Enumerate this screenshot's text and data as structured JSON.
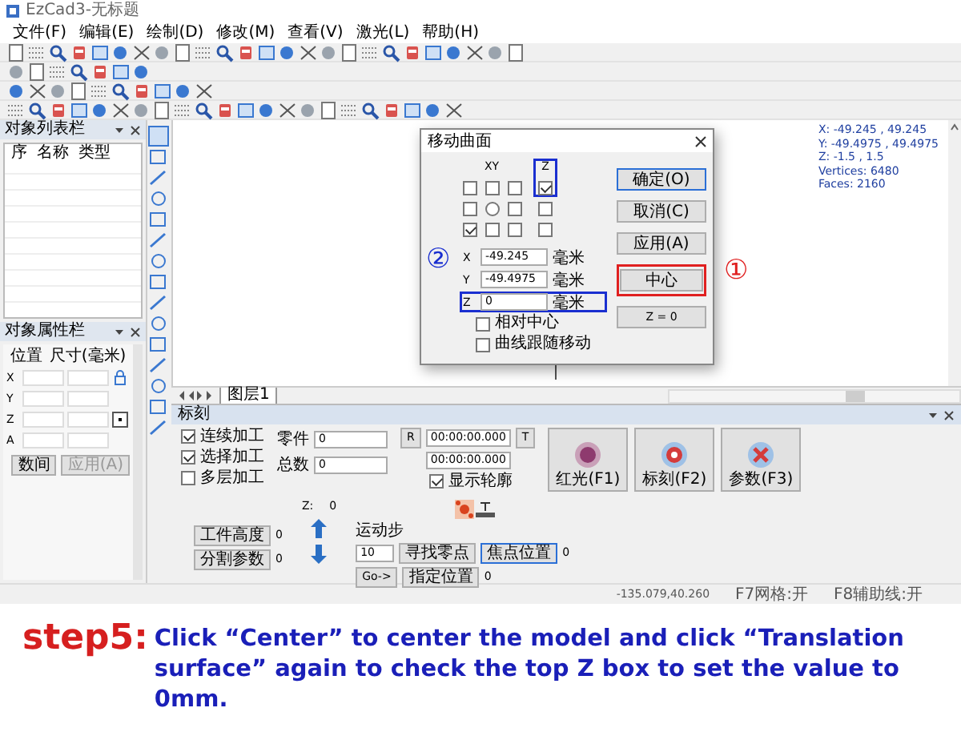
{
  "window": {
    "title": "EzCad3-无标题"
  },
  "menu": [
    "文件(F)",
    "编辑(E)",
    "绘制(D)",
    "修改(M)",
    "查看(V)",
    "激光(L)",
    "帮助(H)"
  ],
  "object_list": {
    "title": "对象列表栏",
    "columns": [
      "序",
      "名称",
      "类型"
    ]
  },
  "object_properties": {
    "title": "对象属性栏",
    "columns": [
      "位置",
      "尺寸(毫米)"
    ],
    "rows": [
      "X",
      "Y",
      "Z",
      "A"
    ],
    "direction_label": "数间",
    "apply_button": {
      "label": "应用(A)",
      "disabled": true
    }
  },
  "canvas": {
    "model_info": [
      "X: -49.245 , 49.245",
      "Y: -49.4975 , 49.4975",
      "Z: -1.5 , 1.5",
      "Vertices: 6480",
      "Faces: 2160"
    ]
  },
  "layer_tabs": [
    {
      "label": "图层1",
      "selected": true
    }
  ],
  "mark_panel": {
    "title": "标刻",
    "options": [
      {
        "label": "连续加工",
        "checked": true
      },
      {
        "label": "选择加工",
        "checked": true
      },
      {
        "label": "多层加工",
        "checked": false
      }
    ],
    "counters": [
      {
        "label": "零件",
        "value": "0"
      },
      {
        "label": "总数",
        "value": "0"
      }
    ],
    "reset_button": "R",
    "timer_button": "T",
    "times": [
      "00:00:00.000",
      "00:00:00.000"
    ],
    "show_outline": {
      "label": "显示轮廓",
      "checked": true
    },
    "actions": [
      {
        "kind": "red-light",
        "label": "红光(F1)"
      },
      {
        "kind": "mark",
        "label": "标刻(F2)"
      },
      {
        "kind": "params",
        "label": "参数(F3)"
      }
    ],
    "z_reading": {
      "label": "Z:",
      "value": "0"
    },
    "settings": [
      {
        "label": "工件高度",
        "value": "0"
      },
      {
        "label": "分割参数",
        "value": "0"
      }
    ],
    "motion": {
      "label": "运动步",
      "step": "10",
      "find_zero": "寻找零点",
      "focus": {
        "label": "焦点位置",
        "value": "0",
        "selected": true
      },
      "go": "Go->",
      "goto": {
        "label": "指定位置",
        "value": "0"
      }
    }
  },
  "status_bar": [
    "-135.079,40.260",
    "F7网格:开",
    "F8辅助线:开"
  ],
  "dialog": {
    "title": "移动曲面",
    "xy_label": "XY",
    "z_label": "Z",
    "z_frame": {
      "color": "#1a2fd0"
    },
    "xy_grid": [
      [
        {
          "kind": "checkbox",
          "checked": false
        },
        {
          "kind": "checkbox",
          "checked": false
        },
        {
          "kind": "checkbox",
          "checked": false
        }
      ],
      [
        {
          "kind": "checkbox",
          "checked": false
        },
        {
          "kind": "radio",
          "checked": false
        },
        {
          "kind": "checkbox",
          "checked": false
        }
      ],
      [
        {
          "kind": "checkbox",
          "checked": true
        },
        {
          "kind": "checkbox",
          "checked": false
        },
        {
          "kind": "checkbox",
          "checked": false
        }
      ]
    ],
    "z_column": [
      {
        "checked": true
      },
      {
        "checked": false
      },
      {
        "checked": false
      }
    ],
    "fields": [
      {
        "label": "X",
        "value": "-49.245",
        "unit": "毫米"
      },
      {
        "label": "Y",
        "value": "-49.4975",
        "unit": "毫米"
      },
      {
        "label": "Z",
        "value": "0",
        "unit": "毫米",
        "frame": {
          "color": "#1a2fd0"
        }
      }
    ],
    "options": [
      {
        "label": "相对中心",
        "checked": false
      },
      {
        "label": "曲线跟随移动",
        "checked": false
      }
    ],
    "buttons": [
      {
        "label": "确定(O)",
        "default": true
      },
      {
        "label": "取消(C)",
        "default": false
      },
      {
        "label": "应用(A)",
        "default": false
      },
      {
        "label": "中心",
        "default": false,
        "frame": {
          "color": "#e02020"
        }
      },
      {
        "label": "Z = 0",
        "default": false
      }
    ]
  },
  "annotations": [
    {
      "label": "①",
      "color": "#e02020"
    },
    {
      "label": "②",
      "color": "#1a2fd0"
    }
  ],
  "caption": {
    "step": "step5:",
    "text": "Click “Center” to center the model and click “Translation surface” again to check the top Z box to set the value to 0mm."
  }
}
